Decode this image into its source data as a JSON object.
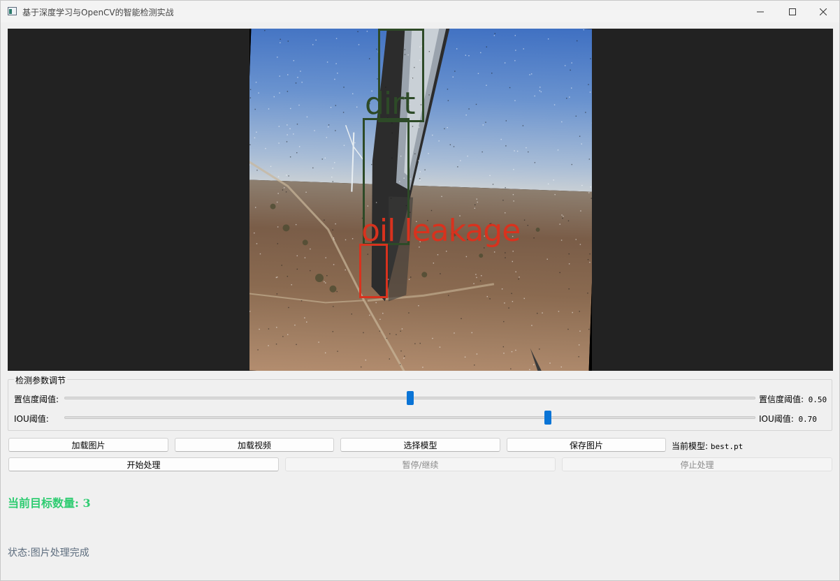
{
  "window": {
    "title": "基于深度学习与OpenCV的智能检测实战",
    "controls": [
      "minimize-icon",
      "maximize-icon",
      "close-icon"
    ]
  },
  "display": {
    "background_color": "#222222",
    "detections": [
      {
        "label": "dirt",
        "color": "#2d4a27"
      },
      {
        "label": "oil leakage",
        "color": "#d8321e"
      },
      {
        "label": "",
        "color": "#d8321e"
      }
    ]
  },
  "params": {
    "group_title": "检测参数调节",
    "confidence": {
      "label": "置信度阈值:",
      "value_label": "置信度阈值:",
      "value": "0.50",
      "fraction": 0.5
    },
    "iou": {
      "label": "IOU阈值:",
      "value_label": "IOU阈值:",
      "value": "0.70",
      "fraction": 0.7
    }
  },
  "buttons": {
    "load_image": "加载图片",
    "load_video": "加载视频",
    "select_model": "选择模型",
    "save_image": "保存图片",
    "start": "开始处理",
    "pause_resume": "暂停/继续",
    "stop": "停止处理"
  },
  "model": {
    "label": "当前模型:",
    "name": "best.pt"
  },
  "target_count": {
    "label": "当前目标数量:",
    "value": "3",
    "color": "#2ecc71"
  },
  "status": {
    "label": "状态:",
    "text": "图片处理完成"
  }
}
